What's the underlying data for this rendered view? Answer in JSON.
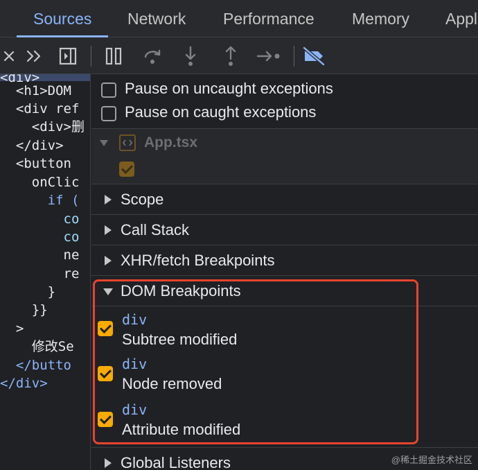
{
  "tabs": [
    {
      "label": "Sources",
      "active": true
    },
    {
      "label": "Network"
    },
    {
      "label": "Performance"
    },
    {
      "label": "Memory"
    },
    {
      "label": "Appl"
    }
  ],
  "toolbar": {
    "icons": [
      "close-icon",
      "more-tabs-icon",
      "toggle-debugger-icon",
      "pause-icon",
      "step-over-icon",
      "step-into-icon",
      "step-out-icon",
      "step-icon",
      "deactivate-breakpoints-icon"
    ],
    "active_color": "#8ab4f8"
  },
  "code": {
    "lines": [
      {
        "text": "<div>"
      },
      {
        "text": "  <h1>DOM "
      },
      {
        "text": "  <div ref"
      },
      {
        "text": "    <div>删"
      },
      {
        "text": "  </div>"
      },
      {
        "text": "  <button "
      },
      {
        "text": "    onClic"
      },
      {
        "text": "      if ("
      },
      {
        "text": "        co"
      },
      {
        "text": "        co"
      },
      {
        "text": "        ne"
      },
      {
        "text": "        re"
      },
      {
        "text": "      }"
      },
      {
        "text": "    }}"
      },
      {
        "text": "  >"
      },
      {
        "text": "    修改Se"
      },
      {
        "text": "  </butto"
      },
      {
        "text": "</div>"
      }
    ]
  },
  "panel": {
    "pause_uncaught": {
      "label": "Pause on uncaught exceptions",
      "checked": false
    },
    "pause_caught": {
      "label": "Pause on caught exceptions",
      "checked": false
    },
    "file": {
      "name": "App.tsx",
      "checked": true
    },
    "sections": {
      "scope": "Scope",
      "call_stack": "Call Stack",
      "xhr": "XHR/fetch Breakpoints",
      "dom": "DOM Breakpoints",
      "global": "Global Listeners"
    },
    "dom_breakpoints": [
      {
        "element": "div",
        "type": "Subtree modified",
        "checked": true
      },
      {
        "element": "div",
        "type": "Node removed",
        "checked": true
      },
      {
        "element": "div",
        "type": "Attribute modified",
        "checked": true
      }
    ]
  },
  "watermark": "@稀土掘金技术社区",
  "colors": {
    "accent": "#8ab4f8",
    "checkbox": "#f9ab00",
    "highlight_border": "#e8432f",
    "background": "#202124"
  }
}
